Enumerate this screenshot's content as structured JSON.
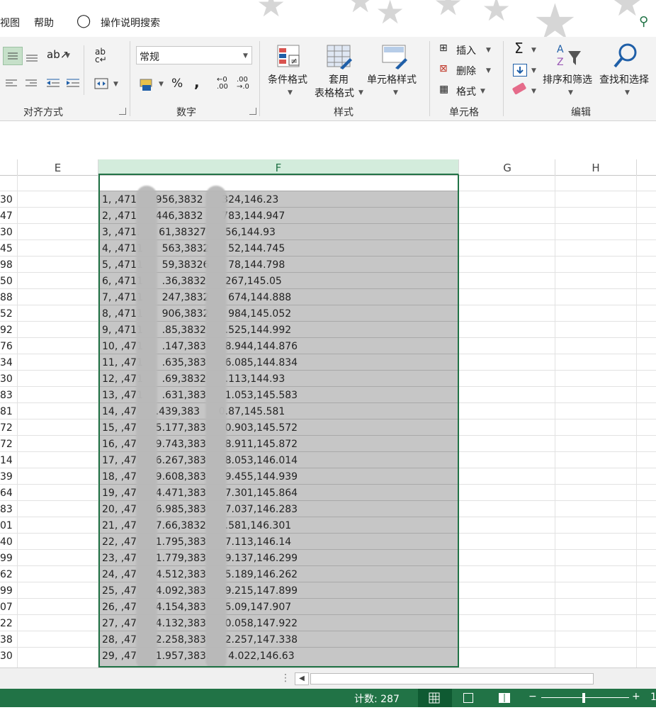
{
  "menu": {
    "view_label": "视图",
    "help_label": "帮助",
    "search_label": "操作说明搜索"
  },
  "ribbon": {
    "alignment_group": "对齐方式",
    "number_group": "数字",
    "number_format": "常规",
    "percent": "%",
    "comma": ",",
    "styles_group": "样式",
    "conditional_format": "条件格式",
    "table_format_1": "套用",
    "table_format_2": "表格格式",
    "cell_styles": "单元格样式",
    "cells_group": "单元格",
    "insert": "插入",
    "delete": "删除",
    "format": "格式",
    "editing_group": "编辑",
    "sort_filter": "排序和筛选",
    "find_select": "查找和选择"
  },
  "columns": [
    "E",
    "F",
    "G",
    "H"
  ],
  "rows": [
    {
      "e": "30",
      "f": "1, ,471      956,3832      324,146.23"
    },
    {
      "e": "47",
      "f": "2, ,471      446,3832      783,144.947"
    },
    {
      "e": "30",
      "f": "3, ,471.      61,38327      56,144.93"
    },
    {
      "e": "45",
      "f": "4, ,4711      563,3832      52,144.745"
    },
    {
      "e": "98",
      "f": "5, ,4711      59,38326      78,144.798"
    },
    {
      "e": "50",
      "f": "6, ,4711      .36,3832      267,145.05"
    },
    {
      "e": "88",
      "f": "7, ,4711      247,3832      674,144.888"
    },
    {
      "e": "52",
      "f": "8, ,4711      906,3832      984,145.052"
    },
    {
      "e": "92",
      "f": "9, ,4711      .85,3832      .525,144.992"
    },
    {
      "e": "76",
      "f": "10, ,471      .147,383      8.944,144.876"
    },
    {
      "e": "34",
      "f": "11, ,471      .635,383      6.085,144.834"
    },
    {
      "e": "30",
      "f": "12, ,471      .69,3832      .113,144.93"
    },
    {
      "e": "83",
      "f": "13, ,471      .631,383      1.053,145.583"
    },
    {
      "e": "81",
      "f": "14, ,47      .439,383      0.87,145.581"
    },
    {
      "e": "72",
      "f": "15, ,47      5.177,383      0.903,145.572"
    },
    {
      "e": "72",
      "f": "16, ,47      9.743,383      8.911,145.872"
    },
    {
      "e": "14",
      "f": "17, ,47      6.267,383      8.053,146.014"
    },
    {
      "e": "39",
      "f": "18, ,47      9.608,383      9.455,144.939"
    },
    {
      "e": "64",
      "f": "19, ,47      4.471,383      7.301,145.864"
    },
    {
      "e": "83",
      "f": "20, ,47      6.985,383      7.037,146.283"
    },
    {
      "e": "01",
      "f": "21, ,47      7.66,3832      .581,146.301"
    },
    {
      "e": "40",
      "f": "22, ,47      1.795,383      7.113,146.14"
    },
    {
      "e": "99",
      "f": "23, ,47      1.779,383      9.137,146.299"
    },
    {
      "e": "62",
      "f": "24, ,47      4.512,383      5.189,146.262"
    },
    {
      "e": "99",
      "f": "25, ,47      4.092,383      9.215,147.899"
    },
    {
      "e": "07",
      "f": "26, ,47      4.154,383      5.09,147.907"
    },
    {
      "e": "22",
      "f": "27, ,47      4.132,383      0.058,147.922"
    },
    {
      "e": "38",
      "f": "28, ,47      2.258,383      2.257,147.338"
    },
    {
      "e": "30",
      "f": "29, ,47      1.957,383.      4.022,146.63"
    }
  ],
  "status": {
    "count": "计数: 287",
    "zoom_minus": "−",
    "zoom_plus": "+",
    "zoom_value": "1"
  },
  "colors": {
    "accent": "#217346",
    "selection": "#c6c6c6",
    "ribbon_bg": "#f3f3f3"
  }
}
